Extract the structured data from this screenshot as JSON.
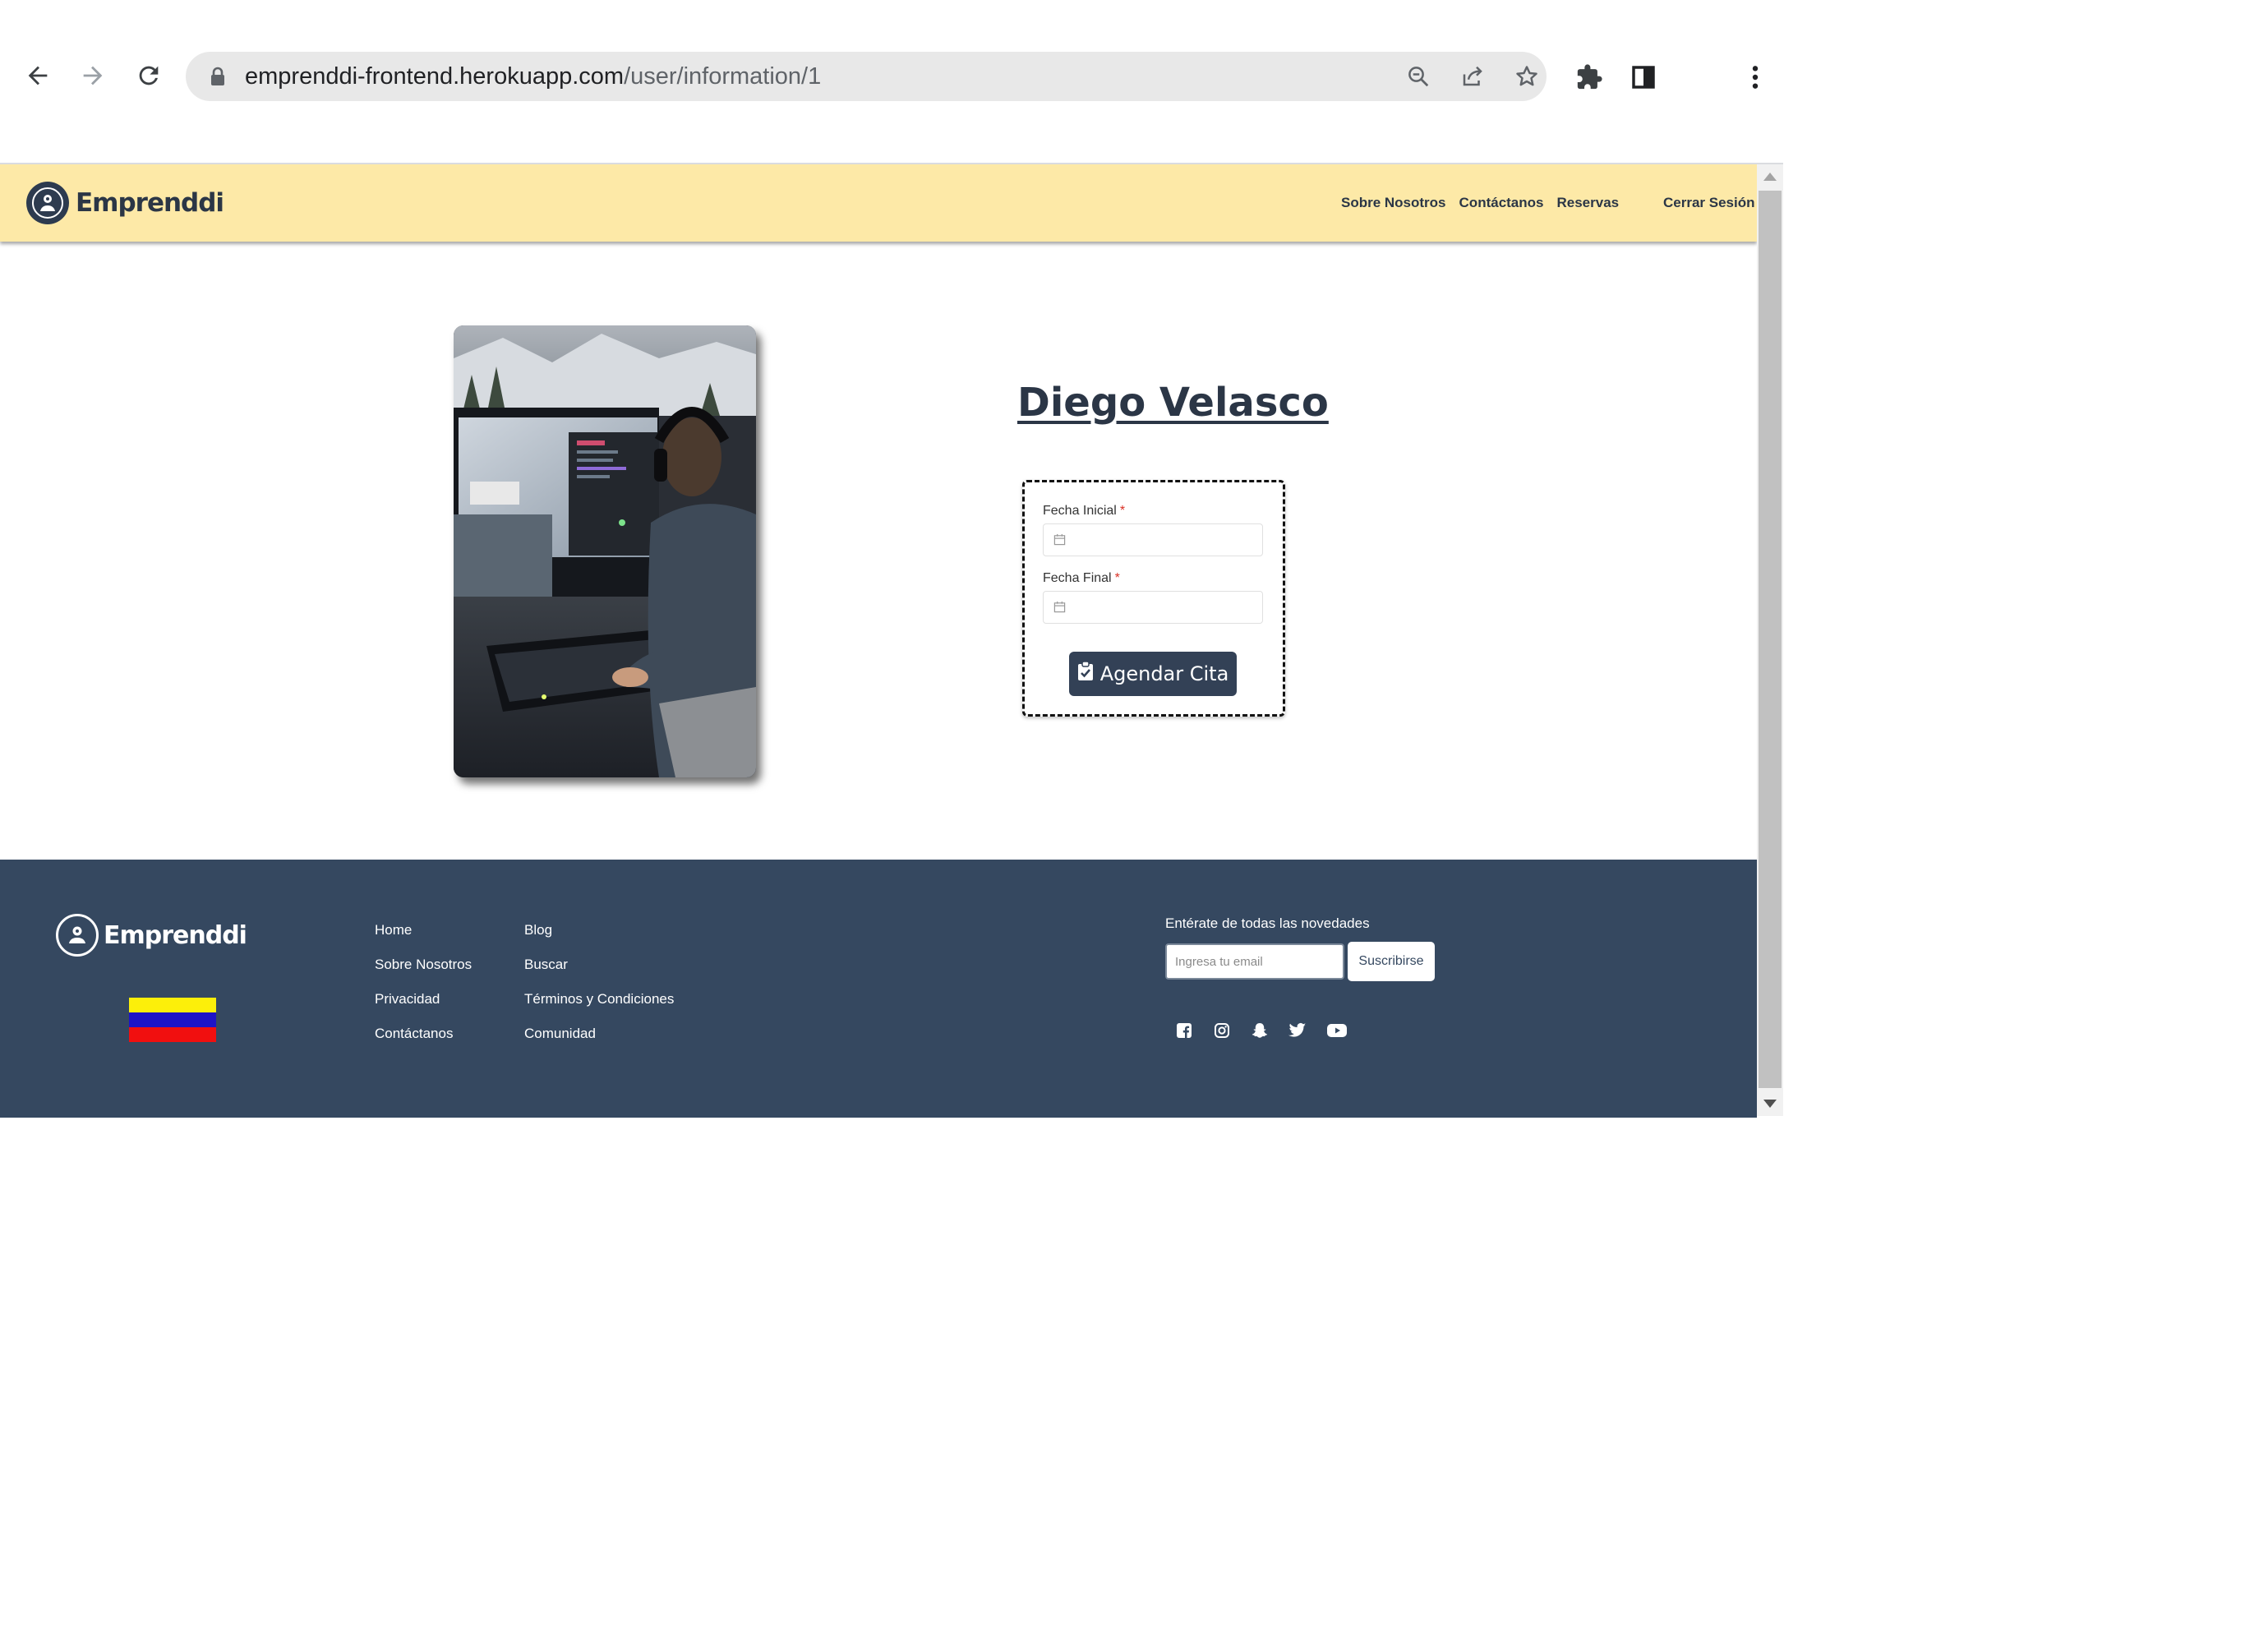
{
  "browser": {
    "url_host": "emprenddi-frontend.herokuapp.com",
    "url_path": "/user/information/1",
    "icons": [
      "back-icon",
      "forward-icon",
      "reload-icon",
      "lock-icon",
      "zoom-icon",
      "share-icon",
      "bookmark-star-icon",
      "extensions-icon",
      "side-panel-icon",
      "menu-dots-icon"
    ]
  },
  "header": {
    "brand": "Emprenddi",
    "nav": {
      "about": "Sobre Nosotros",
      "contact": "Contáctanos",
      "bookings": "Reservas",
      "logout": "Cerrar Sesión"
    }
  },
  "profile": {
    "name": "Diego Velasco"
  },
  "booking_form": {
    "start_label": "Fecha Inicial",
    "end_label": "Fecha Final",
    "required_mark": "*",
    "start_value": "",
    "end_value": "",
    "submit_label": "Agendar Cita"
  },
  "footer": {
    "brand": "Emprenddi",
    "links_col1": [
      "Home",
      "Sobre Nosotros",
      "Privacidad",
      "Contáctanos"
    ],
    "links_col2": [
      "Blog",
      "Buscar",
      "Términos y Condiciones",
      "Comunidad"
    ],
    "newsletter": {
      "title": "Entérate de todas las novedades",
      "placeholder": "Ingresa tu email",
      "button": "Suscribirse"
    },
    "social_icons": [
      "facebook-icon",
      "instagram-icon",
      "snapchat-icon",
      "twitter-icon",
      "youtube-icon"
    ],
    "flag_colors": [
      "#fcef0a",
      "#1d14c7",
      "#f10f0f"
    ]
  },
  "colors": {
    "header_bg": "#fde9a7",
    "dark_accent": "#2b3646",
    "footer_bg": "#354860",
    "button_bg": "#334156"
  }
}
